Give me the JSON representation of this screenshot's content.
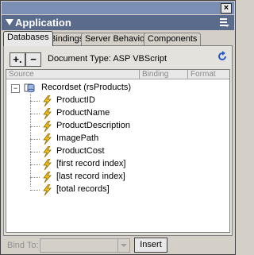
{
  "panel": {
    "title": "Application"
  },
  "tabs": [
    {
      "label": "Databases"
    },
    {
      "label": "Bindings"
    },
    {
      "label": "Server Behaviors"
    },
    {
      "label": "Components"
    }
  ],
  "toolbar": {
    "add_label": "+.",
    "remove_label": "−",
    "doc_type": "Document Type: ASP VBScript"
  },
  "table": {
    "headers": [
      "Source",
      "Binding",
      "Format"
    ],
    "recordset": "Recordset (rsProducts)",
    "fields": [
      "ProductID",
      "ProductName",
      "ProductDescription",
      "ImagePath",
      "ProductCost",
      "[first record index]",
      "[last record index]",
      "[total records]"
    ]
  },
  "bottom": {
    "bind_to_label": "Bind To:",
    "insert_label": "Insert"
  },
  "colors": {
    "title_bar": "#5a6b8c",
    "bolt": "#f2c21b"
  }
}
